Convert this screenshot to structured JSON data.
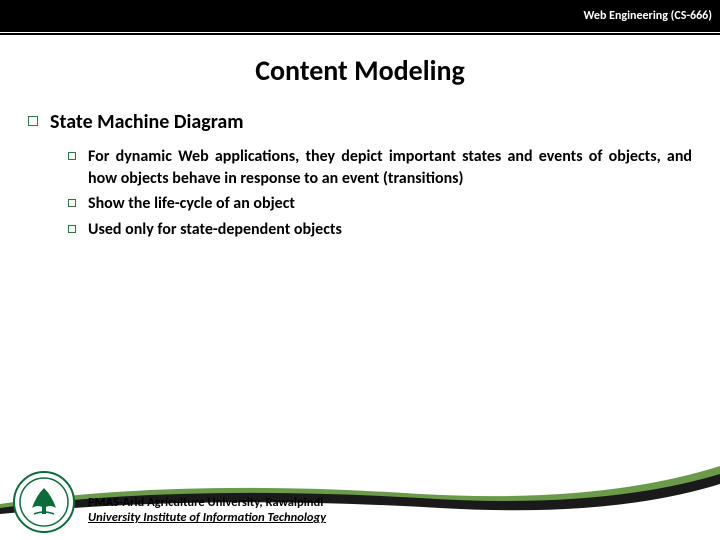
{
  "header": {
    "course": "Web Engineering (CS-666)"
  },
  "title": "Content Modeling",
  "main": {
    "heading": "State Machine Diagram",
    "items": [
      "For dynamic Web applications, they depict important states and events of objects, and how objects behave in response to an event (transitions)",
      "Show the life-cycle of an object",
      "Used only for state-dependent objects"
    ]
  },
  "footer": {
    "line1": "PMAS-Arid Agriculture University, Rawalpindi",
    "line2": "University Institute of Information Technology"
  },
  "colors": {
    "bullet_border": "#2d7a3a",
    "swoosh_dark": "#1a1a1a",
    "swoosh_green": "#5a8a3a",
    "logo_green": "#0d6b3a"
  }
}
